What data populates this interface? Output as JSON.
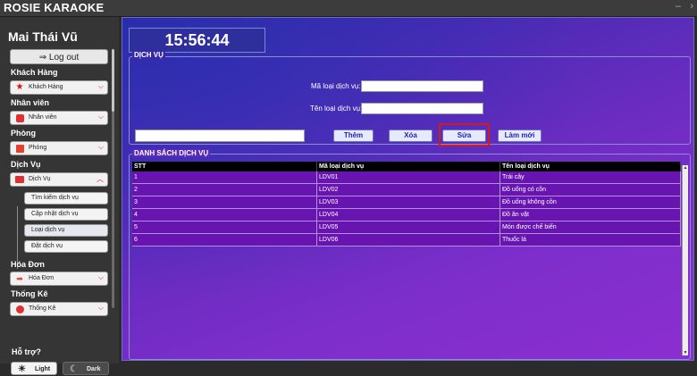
{
  "window": {
    "title": "ROSIE KARAOKE",
    "minimize_glyph": "–",
    "maximize_glyph": "›"
  },
  "sidebar": {
    "user_name": "Mai Thái Vũ",
    "logout_label": "Log out",
    "logout_icon": "⇒",
    "sections": [
      {
        "label": "Khách Hàng",
        "dropdown_label": "Khách Hàng",
        "icon": "star-icon"
      },
      {
        "label": "Nhân viên",
        "dropdown_label": "Nhân viên",
        "icon": "employee-icon"
      },
      {
        "label": "Phòng",
        "dropdown_label": "Phòng",
        "icon": "room-icon"
      },
      {
        "label": "Dịch Vụ",
        "dropdown_label": "Dịch Vụ",
        "icon": "service-icon"
      },
      {
        "label": "Hóa Đơn",
        "dropdown_label": "Hóa Đơn",
        "icon": "invoice-icon"
      },
      {
        "label": "Thống Kê",
        "dropdown_label": "Thống Kê",
        "icon": "stats-icon"
      }
    ],
    "service_subitems": [
      "Tìm kiếm dịch vụ",
      "Cập nhật dịch vụ",
      "Loại dịch vụ",
      "Đặt dịch vụ"
    ],
    "active_subitem": "Loại dịch vụ",
    "support_label": "Hỗ trợ?",
    "theme_light": "Light",
    "theme_dark": "Dark"
  },
  "main": {
    "clock": "15:56:44",
    "service_group_title": "DỊCH VỤ",
    "ma_loai_label": "Mã loại dịch vụ:",
    "ma_loai_value": "",
    "ten_loai_label": "Tên loại dịch vụ:",
    "ten_loai_value": "",
    "search_value": "",
    "buttons": {
      "add": "Thêm",
      "delete": "Xóa",
      "edit": "Sửa",
      "refresh": "Làm mới"
    },
    "table_title": "DANH SÁCH DỊCH VỤ",
    "table": {
      "headers": [
        "STT",
        "Mã loại dịch vụ",
        "Tên loại dịch vụ"
      ],
      "rows": [
        [
          "1",
          "LDV01",
          "Trái cây"
        ],
        [
          "2",
          "LDV02",
          "Đồ uống có cồn"
        ],
        [
          "3",
          "LDV03",
          "Đồ uống không cồn"
        ],
        [
          "4",
          "LDV04",
          "Đồ ăn vặt"
        ],
        [
          "5",
          "LDV05",
          "Món được chế biến"
        ],
        [
          "6",
          "LDV06",
          "Thuốc lá"
        ]
      ]
    }
  },
  "colors": {
    "accent": "#1d29a8",
    "highlight": "#d11b1b",
    "row_bg": "#6814b0"
  }
}
